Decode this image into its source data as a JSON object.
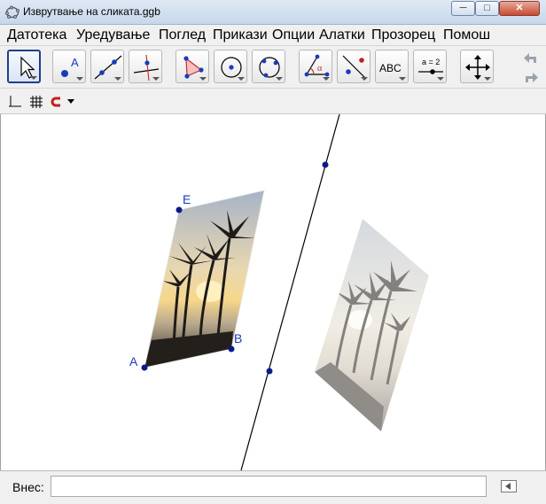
{
  "window": {
    "title": "Изврутвање на сликата.ggb",
    "controls": {
      "minimize": "─",
      "maximize": "□",
      "close": "✕"
    }
  },
  "menu": [
    {
      "label": "Датотека"
    },
    {
      "label": "Уредување"
    },
    {
      "label": "Поглед"
    },
    {
      "label": "Прикази"
    },
    {
      "label": "Опции"
    },
    {
      "label": "Алатки"
    },
    {
      "label": "Прозорец"
    },
    {
      "label": "Помош"
    }
  ],
  "toolbar": {
    "tools": [
      {
        "icon": "move-arrow-icon",
        "active": true
      },
      {
        "icon": "new-point-icon"
      },
      {
        "icon": "line-through-two-points-icon"
      },
      {
        "icon": "perpendicular-line-icon"
      },
      {
        "icon": "polygon-icon"
      },
      {
        "icon": "circle-center-point-icon"
      },
      {
        "icon": "circle-three-points-icon"
      },
      {
        "icon": "angle-icon"
      },
      {
        "icon": "reflect-about-line-icon"
      },
      {
        "icon": "text-icon",
        "label": "ABC"
      },
      {
        "icon": "slider-icon",
        "label": "a = 2"
      },
      {
        "icon": "move-graphics-view-icon"
      }
    ],
    "undo_icon": "undo-icon",
    "redo_icon": "redo-icon"
  },
  "stylebar": {
    "axes_icon": "axes-icon",
    "grid_icon": "grid-icon",
    "snap_icon": "point-capturing-magnet-icon",
    "dropdown_icon": "chevron-down-icon"
  },
  "graphics": {
    "points": [
      {
        "label": "E"
      },
      {
        "label": "B"
      },
      {
        "label": "A"
      }
    ],
    "point_color": "#0a1a8c",
    "image_alt": "palm trees at sunset"
  },
  "input_bar": {
    "label": "Внес:",
    "value": "",
    "placeholder": ""
  }
}
